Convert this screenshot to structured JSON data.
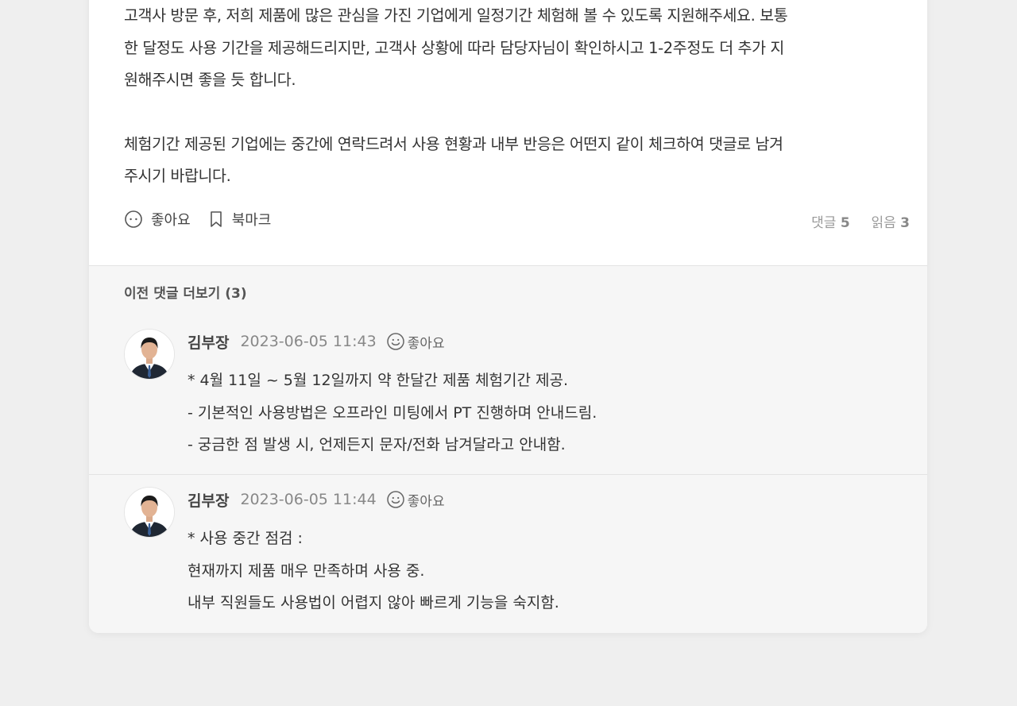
{
  "post": {
    "paragraphs": [
      [
        "고객사 방문 후, 저희 제품에 많은 관심을 가진 기업에게 일정기간 체험해 볼 수 있도록 지원해주세요. 보통",
        "한 달정도 사용 기간을 제공해드리지만, 고객사 상황에 따라 담당자님이 확인하시고 1-2주정도 더 추가 지",
        "원해주시면 좋을 듯 합니다."
      ],
      [
        "체험기간 제공된 기업에는 중간에 연락드려서 사용 현황과 내부 반응은 어떤지 같이 체크하여 댓글로 남겨",
        "주시기 바랍니다."
      ]
    ],
    "like_label": "좋아요",
    "bookmark_label": "북마크",
    "comments_label": "댓글",
    "comments_count": "5",
    "reads_label": "읽음",
    "reads_count": "3"
  },
  "comments_section": {
    "more_label": "이전 댓글 더보기 (3)",
    "items": [
      {
        "author": "김부장",
        "time": "2023-06-05 11:43",
        "like_label": "좋아요",
        "lines": [
          "* 4월 11일 ~ 5월 12일까지 약 한달간 제품 체험기간 제공.",
          "- 기본적인 사용방법은 오프라인 미팅에서 PT 진행하며 안내드림.",
          "- 궁금한 점 발생 시, 언제든지 문자/전화 남겨달라고 안내함."
        ]
      },
      {
        "author": "김부장",
        "time": "2023-06-05 11:44",
        "like_label": "좋아요",
        "lines": [
          "* 사용 중간 점검 :",
          "현재까지 제품 매우 만족하며 사용 중.",
          "내부 직원들도 사용법이 어렵지 않아 빠르게 기능을 숙지함."
        ]
      }
    ]
  },
  "icons": {
    "like": "smile-icon",
    "bookmark": "bookmark-icon",
    "avatar": "avatar-photo"
  },
  "colors": {
    "page_bg": "#efefef",
    "card_bg": "#ffffff",
    "comments_bg": "#f6f6f6",
    "muted_text": "#888888"
  }
}
